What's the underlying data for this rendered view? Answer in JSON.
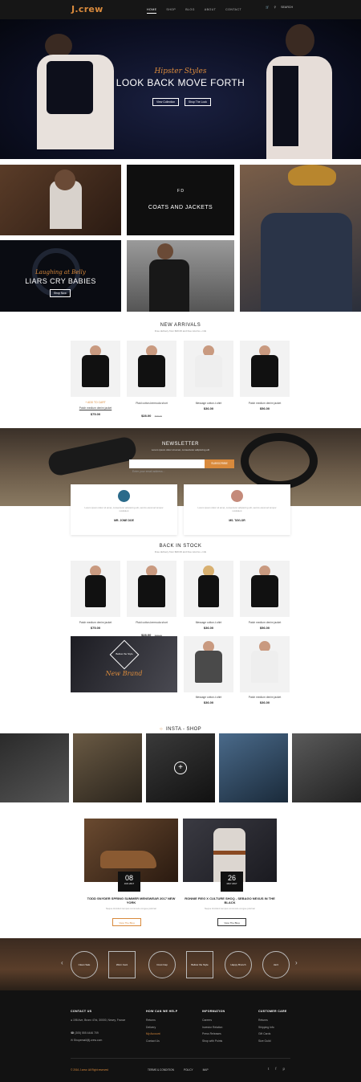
{
  "header": {
    "logo": "J.crew",
    "nav": [
      "HOME",
      "SHOP",
      "BLOG",
      "ABOUT",
      "CONTACT"
    ],
    "search_label": "SEARCH"
  },
  "hero": {
    "script": "Hipster Styles",
    "title": "LOOK BACK MOVE FORTH",
    "btn1": "View Collection",
    "btn2": "Shop The Look"
  },
  "promo": {
    "coats_title": "COATS AND JACKETS",
    "coats_logo": "F D",
    "liars_script": "Laughing at Belly",
    "liars_title": "LIARS CRY BABIES",
    "liars_btn": "Shop Now"
  },
  "new_arrivals": {
    "title": "NEW ARRIVALS",
    "subtitle": "Free delivery from $20.00 and free returns + info",
    "add_to_cart": "+ ADD TO CART",
    "products": [
      {
        "name": "Patch medium denim jacket",
        "price": "$75.00",
        "old": ""
      },
      {
        "name": "Plaid cotton-bermuda short",
        "price": "$28.00",
        "old": "$38.00"
      },
      {
        "name": "Message cotton-t-shirt",
        "price": "$36.00",
        "old": ""
      },
      {
        "name": "Patch medium denim jacket",
        "price": "$56.00",
        "old": ""
      }
    ]
  },
  "newsletter": {
    "title": "NEWSLETTER",
    "subtitle": "Lorem ipsum dolor sit amet, consectetur adipiscing elit",
    "placeholder": "Enter your email address...",
    "button": "SUBSCRIBE"
  },
  "testimonials": [
    {
      "text": "Lorem ipsum dolor sit amet, consectetur adipiscing elit, sed do eiusmod tempor incididunt",
      "name": "MR. JONE DOE"
    },
    {
      "text": "Lorem ipsum dolor sit amet, consectetur adipiscing elit, sed do eiusmod tempor incididunt",
      "name": "MS. TAYLOR"
    }
  ],
  "back_in_stock": {
    "title": "BACK IN STOCK",
    "subtitle": "Free delivery from $20.00 and free returns + info",
    "products": [
      {
        "name": "Patch medium denim jacket",
        "price": "$75.00",
        "old": ""
      },
      {
        "name": "Plaid cotton-bermuda short",
        "price": "$28.00",
        "old": "$38.00"
      },
      {
        "name": "Message cotton-t-shirt",
        "price": "$36.00",
        "old": ""
      },
      {
        "name": "Patch medium denim jacket",
        "price": "$56.00",
        "old": ""
      },
      {
        "name": "Message cotton-t-shirt",
        "price": "$36.00",
        "old": ""
      },
      {
        "name": "Patch medium denim jacket",
        "price": "$36.00",
        "old": ""
      }
    ],
    "banner_badge": "Bellow the Style",
    "banner_script": "New Brand"
  },
  "insta": {
    "title": "INSTA - SHOP"
  },
  "blog": [
    {
      "day": "08",
      "month": "JUN 2017",
      "title": "TODD SNYDER SPRING SUMMER MENSWEAR 2017 NEW YORK",
      "excerpt": "Neque tincidunt tempus commodo congue pulvinar",
      "button": "View The Blog"
    },
    {
      "day": "26",
      "month": "MAY 2017",
      "title": "RONNIE FIEG X CULTURE SHOQ - SEBAGO NEXUS IN THE BLACK",
      "excerpt": "Neque tincidunt tempus commodo congue pulvinar",
      "button": "View The Blog"
    }
  ],
  "brands": [
    "Clean Sale",
    "Worn Cent",
    "Crest Cap",
    "Bellow the Style",
    "Happy Brunch",
    "Jazz"
  ],
  "footer": {
    "contact_title": "CONTACT US",
    "address": "198 Ave, Bronx 47st, 30000, Newry, France",
    "phone": "(305) 555 4446 709",
    "email": "Shopemail@j.crew.com",
    "help_title": "HOW CAN WE HELP",
    "help": [
      "Returns",
      "Delivery",
      "My Account",
      "Contact Us"
    ],
    "info_title": "INFORMATION",
    "info": [
      "Careers",
      "Investor Relation",
      "Press Releases",
      "Shop with Points"
    ],
    "care_title": "CUSTOMER CARE",
    "care": [
      "Returns",
      "Shipping Info",
      "Gift Cards",
      "Size Guild"
    ],
    "copyright": "© 2016 J.crew. All Right reserved",
    "links": [
      "TERMS & CONDITION",
      "POLICY",
      "MAP"
    ],
    "social": [
      "twitter-icon",
      "facebook-icon",
      "pinterest-icon"
    ]
  },
  "colors": {
    "accent": "#d98a3c",
    "dark": "#161616"
  }
}
